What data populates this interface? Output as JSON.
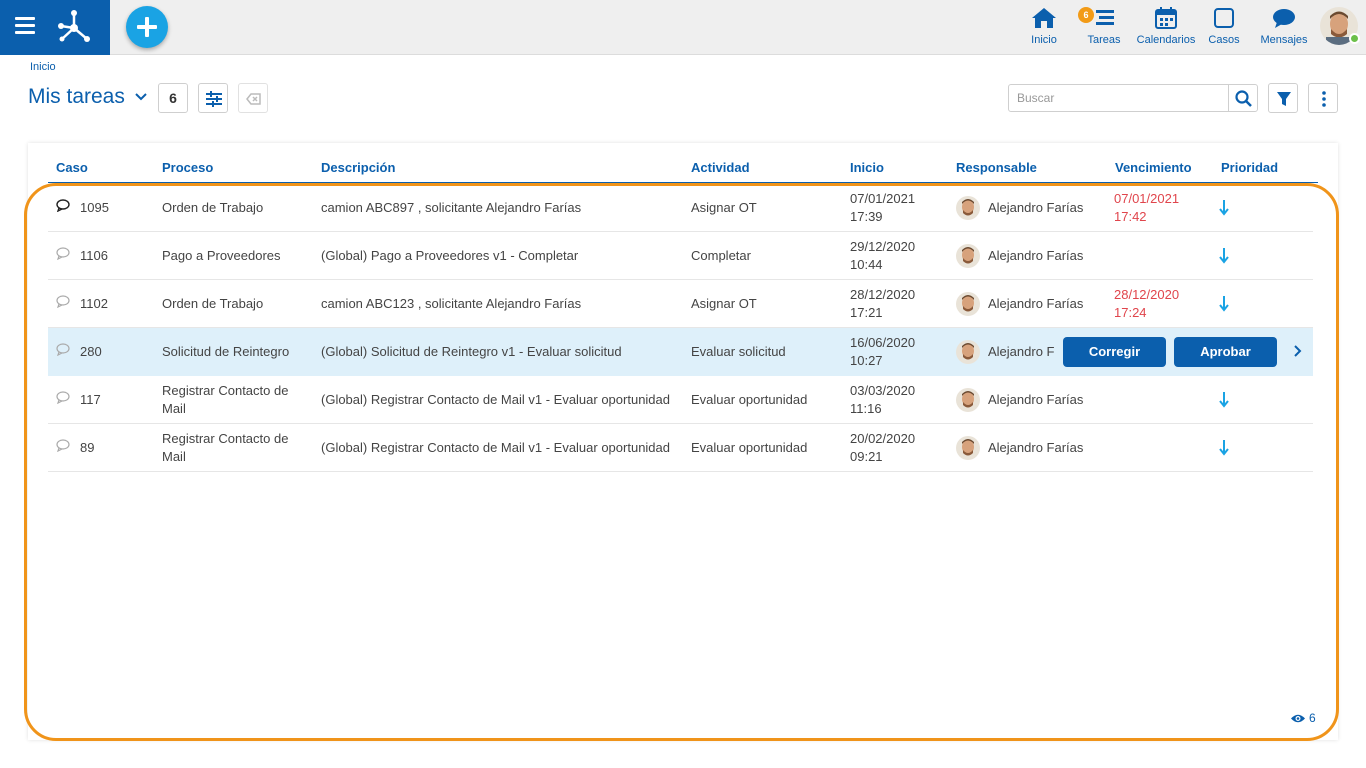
{
  "topbar": {
    "nav": [
      {
        "label": "Inicio",
        "icon": "home-icon"
      },
      {
        "label": "Tareas",
        "icon": "tasks-icon",
        "badge": "6"
      },
      {
        "label": "Calendarios",
        "icon": "calendar-icon"
      },
      {
        "label": "Casos",
        "icon": "cases-icon"
      },
      {
        "label": "Mensajes",
        "icon": "messages-icon"
      }
    ]
  },
  "breadcrumb": "Inicio",
  "header": {
    "title": "Mis tareas",
    "count": "6",
    "search_placeholder": "Buscar"
  },
  "table": {
    "columns": [
      "Caso",
      "Proceso",
      "Descripción",
      "Actividad",
      "Inicio",
      "Responsable",
      "Vencimiento",
      "Prioridad"
    ],
    "rows": [
      {
        "case": "1095",
        "process": "Orden de Trabajo",
        "description": "camion ABC897 , solicitante Alejandro Farías",
        "activity": "Asignar OT",
        "start_date": "07/01/2021",
        "start_time": "17:39",
        "responsible": "Alejandro Farías",
        "due_date": "07/01/2021",
        "due_time": "17:42",
        "unread": true
      },
      {
        "case": "1106",
        "process": "Pago a Proveedores",
        "description": "(Global) Pago a Proveedores v1 - Completar",
        "activity": "Completar",
        "start_date": "29/12/2020",
        "start_time": "10:44",
        "responsible": "Alejandro Farías",
        "due_date": "",
        "due_time": "",
        "unread": false
      },
      {
        "case": "1102",
        "process": "Orden de Trabajo",
        "description": "camion ABC123 , solicitante Alejandro Farías",
        "activity": "Asignar OT",
        "start_date": "28/12/2020",
        "start_time": "17:21",
        "responsible": "Alejandro Farías",
        "due_date": "28/12/2020",
        "due_time": "17:24",
        "unread": false
      },
      {
        "case": "280",
        "process": "Solicitud de Reintegro",
        "description": "(Global) Solicitud de Reintegro v1 - Evaluar solicitud",
        "activity": "Evaluar solicitud",
        "start_date": "16/06/2020",
        "start_time": "10:27",
        "responsible": "Alejandro F",
        "due_date": "",
        "due_time": "",
        "unread": false
      },
      {
        "case": "117",
        "process_line1": "Registrar Contacto de",
        "process_line2": "Mail",
        "description": "(Global) Registrar Contacto de Mail v1 - Evaluar oportunidad",
        "activity": "Evaluar oportunidad",
        "start_date": "03/03/2020",
        "start_time": "11:16",
        "responsible": "Alejandro Farías",
        "due_date": "",
        "due_time": "",
        "unread": false
      },
      {
        "case": "89",
        "process_line1": "Registrar Contacto de",
        "process_line2": "Mail",
        "description": "(Global) Registrar Contacto de Mail v1 - Evaluar oportunidad",
        "activity": "Evaluar oportunidad",
        "start_date": "20/02/2020",
        "start_time": "09:21",
        "responsible": "Alejandro Farías",
        "due_date": "",
        "due_time": "",
        "unread": false
      }
    ],
    "selected_actions": {
      "correct": "Corregir",
      "approve": "Aprobar"
    }
  },
  "footer": {
    "visible_count": "6"
  },
  "colors": {
    "primary": "#0b5fad",
    "accent": "#1aa3e4",
    "badge": "#f29b17",
    "due": "#e0454c",
    "highlight": "#f0941a",
    "selected_row": "#def0fa"
  }
}
